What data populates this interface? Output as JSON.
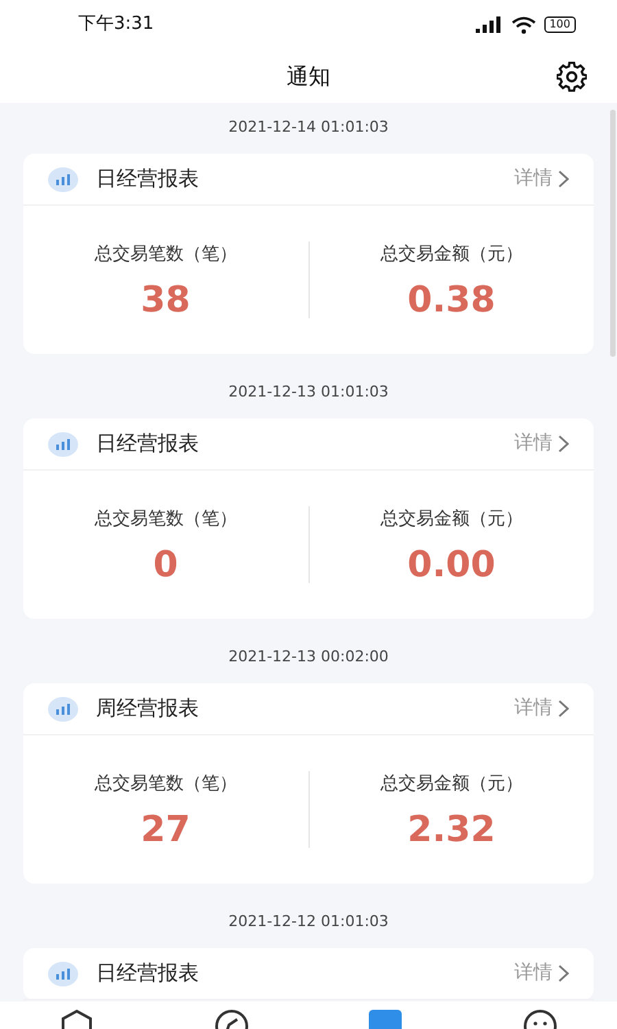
{
  "status_bar": {
    "time": "下午3:31",
    "battery": "100"
  },
  "header": {
    "title": "通知"
  },
  "reports": [
    {
      "date": "2021-12-14 01:01:03",
      "title": "日经营报表",
      "detail": "详情",
      "stats": [
        {
          "label": "总交易笔数（笔）",
          "value": "38"
        },
        {
          "label": "总交易金额（元）",
          "value": "0.38"
        }
      ]
    },
    {
      "date": "2021-12-13 01:01:03",
      "title": "日经营报表",
      "detail": "详情",
      "stats": [
        {
          "label": "总交易笔数（笔）",
          "value": "0"
        },
        {
          "label": "总交易金额（元）",
          "value": "0.00"
        }
      ]
    },
    {
      "date": "2021-12-13 00:02:00",
      "title": "周经营报表",
      "detail": "详情",
      "stats": [
        {
          "label": "总交易笔数（笔）",
          "value": "27"
        },
        {
          "label": "总交易金额（元）",
          "value": "2.32"
        }
      ]
    },
    {
      "date": "2021-12-12 01:01:03",
      "title": "日经营报表",
      "detail": "详情"
    }
  ],
  "bottom_nav": [
    {
      "kind": "hexagon",
      "selected": false
    },
    {
      "kind": "compass",
      "selected": false
    },
    {
      "kind": "square",
      "selected": true
    },
    {
      "kind": "face",
      "selected": false
    }
  ]
}
